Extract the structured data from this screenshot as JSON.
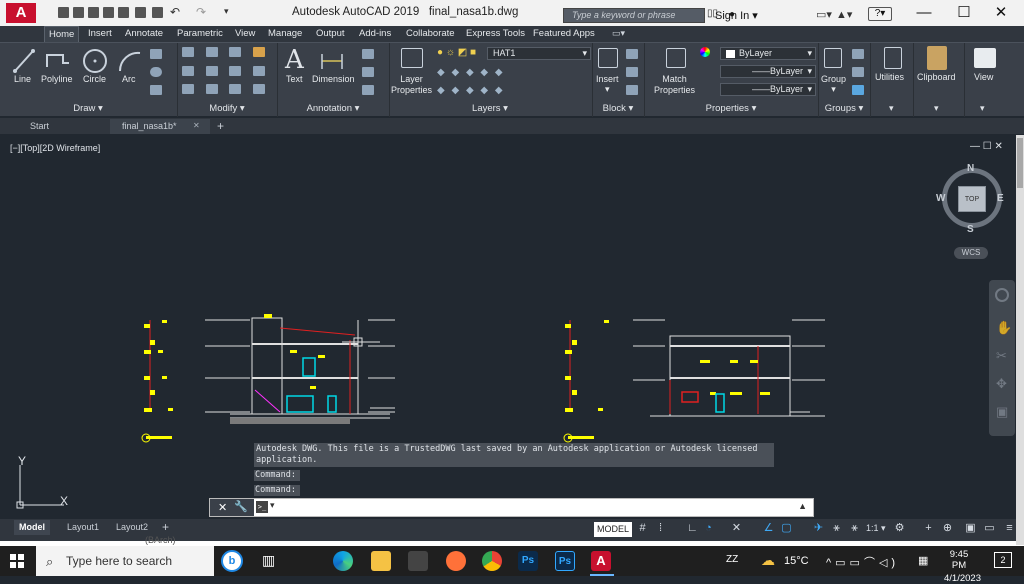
{
  "titlebar": {
    "app_name": "Autodesk AutoCAD 2019",
    "file_name": "final_nasa1b.dwg",
    "search_placeholder": "Type a keyword or phrase",
    "sign_in": "Sign In",
    "help": "?"
  },
  "ribbon_tabs": [
    "Home",
    "Insert",
    "Annotate",
    "Parametric",
    "View",
    "Manage",
    "Output",
    "Add-ins",
    "Collaborate",
    "Express Tools",
    "Featured Apps"
  ],
  "ribbon": {
    "draw": {
      "title": "Draw",
      "tools": [
        "Line",
        "Polyline",
        "Circle",
        "Arc"
      ]
    },
    "modify": {
      "title": "Modify"
    },
    "annotation": {
      "title": "Annotation",
      "tools": [
        "Text",
        "Dimension"
      ]
    },
    "layers": {
      "title": "Layers",
      "tool": "Layer Properties",
      "current_layer": "HAT1"
    },
    "block": {
      "title": "Block",
      "tool": "Insert"
    },
    "properties": {
      "title": "Properties",
      "tool": "Match Properties",
      "color": "ByLayer",
      "linetype": "ByLayer",
      "lineweight": "ByLayer"
    },
    "groups": {
      "title": "Groups",
      "tool": "Group"
    },
    "utilities": "Utilities",
    "clipboard": "Clipboard",
    "view": "View"
  },
  "file_tabs": {
    "start": "Start",
    "active": "final_nasa1b*"
  },
  "viewport": {
    "label": "[−][Top][2D Wireframe]",
    "viewcube": {
      "north": "N",
      "south": "S",
      "east": "E",
      "west": "W",
      "face": "TOP",
      "ucs": "WCS"
    },
    "ucs_icon": {
      "y": "Y"
    }
  },
  "command": {
    "history": "Autodesk DWG.  This file is a TrustedDWG last saved by an Autodesk application or Autodesk licensed application.",
    "line1": "Command:",
    "line2": "Command:",
    "prompt_symbol": ">_"
  },
  "status": {
    "layouts": [
      "Model",
      "Layout1",
      "Layout2"
    ],
    "model_label": "MODEL",
    "scale": "1:1"
  },
  "below_strip_text": "(BArch)",
  "taskbar": {
    "search_placeholder": "Type here to search",
    "weather": "15°C",
    "time": "9:45 PM",
    "date": "4/1/2023",
    "notifications": "2",
    "zz": "ZZ"
  },
  "colors": {
    "accent_red": "#c8102e",
    "drawing_yellow": "#ffff00",
    "drawing_cyan": "#00d8e6",
    "drawing_red": "#e02020",
    "drawing_white": "#f0f0f0",
    "drawing_magenta": "#ff30ff"
  }
}
